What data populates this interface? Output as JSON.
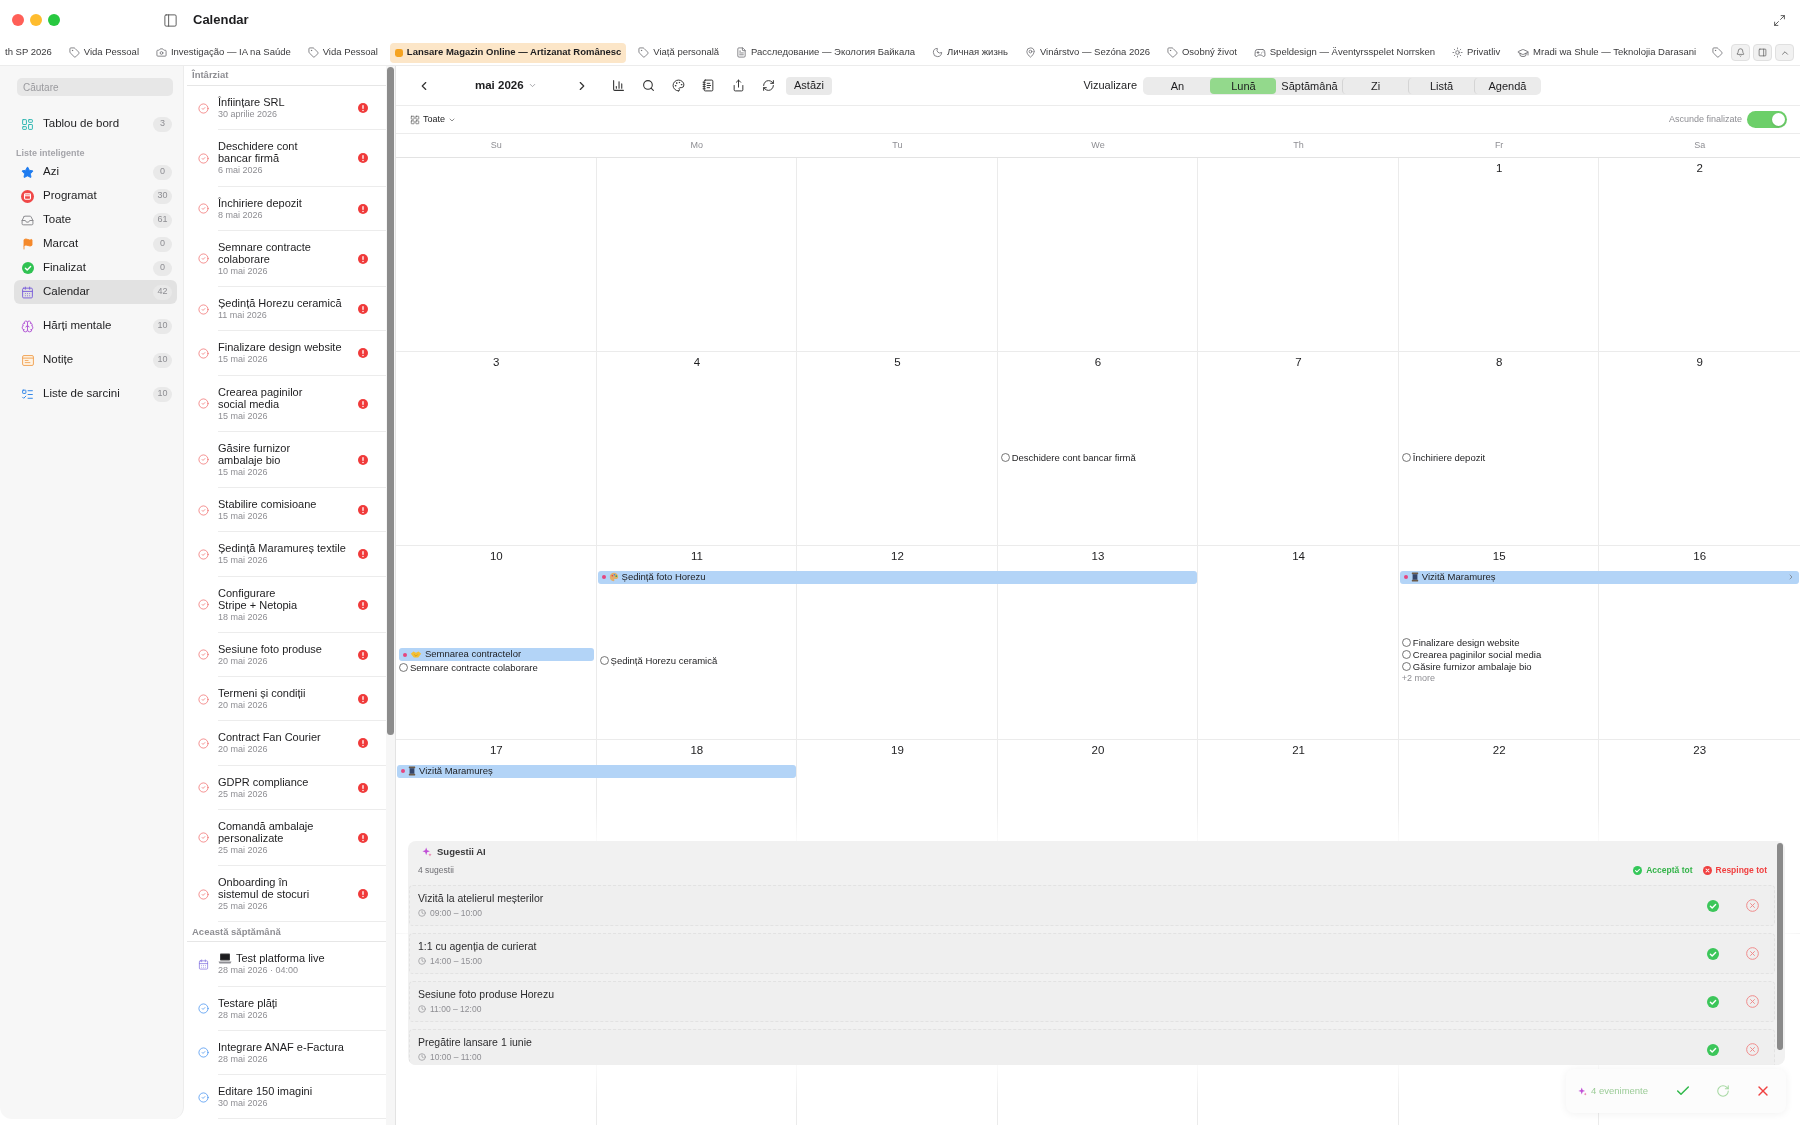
{
  "window": {
    "title": "Calendar"
  },
  "tabs": [
    {
      "label": "th SP 2026",
      "selected": false
    },
    {
      "label": "Vida Pessoal",
      "selected": false
    },
    {
      "label": "Investigação — IA na Saúde",
      "selected": false
    },
    {
      "label": "Vida Pessoal",
      "selected": false
    },
    {
      "label": "Lansare Magazin Online — Artizanat Românesc",
      "selected": true
    },
    {
      "label": "Viață personală",
      "selected": false
    },
    {
      "label": "Расследование — Экология Байкала",
      "selected": false
    },
    {
      "label": "Личная жизнь",
      "selected": false
    },
    {
      "label": "Vinárstvo — Sezóna 2026",
      "selected": false
    },
    {
      "label": "Osobný život",
      "selected": false
    },
    {
      "label": "Speldesign — Äventyrsspelet Norrsken",
      "selected": false
    },
    {
      "label": "Privatliv",
      "selected": false
    },
    {
      "label": "Mradi wa Shule — Teknolojia Darasani",
      "selected": false
    }
  ],
  "sidebar": {
    "search": {
      "placeholder": "Căutare"
    },
    "top_items": [
      {
        "label": "Tablou de bord",
        "count": "3",
        "selected": false
      }
    ],
    "smart_lists": {
      "title": "Liste inteligente",
      "items": [
        {
          "label": "Azi",
          "count": "0",
          "selected": false
        },
        {
          "label": "Programat",
          "count": "30",
          "selected": false
        },
        {
          "label": "Toate",
          "count": "61",
          "selected": false
        },
        {
          "label": "Marcat",
          "count": "0",
          "selected": false
        },
        {
          "label": "Finalizat",
          "count": "0",
          "selected": false
        },
        {
          "label": "Calendar",
          "count": "42",
          "selected": true
        }
      ]
    },
    "bottom_items": [
      {
        "label": "Hărți mentale",
        "count": "10",
        "selected": false
      },
      {
        "label": "Notițe",
        "count": "10",
        "selected": false
      },
      {
        "label": "Liste de sarcini",
        "count": "10",
        "selected": false
      }
    ]
  },
  "task_list": {
    "groups": [
      {
        "title": "Întârziat",
        "items": [
          {
            "kind": "task",
            "title": "Înființare SRL",
            "date": "30 aprilie 2026",
            "overdue": true
          },
          {
            "kind": "task",
            "title": "Deschidere cont bancar firmă",
            "date": "6 mai 2026",
            "overdue": true
          },
          {
            "kind": "task",
            "title": "Închiriere depozit",
            "date": "8 mai 2026",
            "overdue": true
          },
          {
            "kind": "task",
            "title": "Semnare contracte colaborare",
            "date": "10 mai 2026",
            "overdue": true
          },
          {
            "kind": "task",
            "title": "Ședință Horezu ceramică",
            "date": "11 mai 2026",
            "overdue": true
          },
          {
            "kind": "task",
            "title": "Finalizare design website",
            "date": "15 mai 2026",
            "overdue": true
          },
          {
            "kind": "task",
            "title": "Crearea paginilor social media",
            "date": "15 mai 2026",
            "overdue": true
          },
          {
            "kind": "task",
            "title": "Găsire furnizor ambalaje bio",
            "date": "15 mai 2026",
            "overdue": true
          },
          {
            "kind": "task",
            "title": "Stabilire comisioane",
            "date": "15 mai 2026",
            "overdue": true
          },
          {
            "kind": "task",
            "title": "Ședință Maramureș textile",
            "date": "15 mai 2026",
            "overdue": true
          },
          {
            "kind": "task",
            "title": "Configurare Stripe + Netopia",
            "date": "18 mai 2026",
            "overdue": true
          },
          {
            "kind": "task",
            "title": "Sesiune foto produse",
            "date": "20 mai 2026",
            "overdue": true
          },
          {
            "kind": "task",
            "title": "Termeni și condiții",
            "date": "20 mai 2026",
            "overdue": true
          },
          {
            "kind": "task",
            "title": "Contract Fan Courier",
            "date": "20 mai 2026",
            "overdue": true
          },
          {
            "kind": "task",
            "title": "GDPR compliance",
            "date": "25 mai 2026",
            "overdue": true
          },
          {
            "kind": "task",
            "title": "Comandă ambalaje personalizate",
            "date": "25 mai 2026",
            "overdue": true
          },
          {
            "kind": "task",
            "title": "Onboarding în sistemul de stocuri",
            "date": "25 mai 2026",
            "overdue": true
          }
        ]
      },
      {
        "title": "Această săptămână",
        "items": [
          {
            "kind": "event",
            "title": "Test platforma live",
            "date": "28 mai 2026 · 04:00",
            "overdue": false
          },
          {
            "kind": "task",
            "title": "Testare plăți",
            "date": "28 mai 2026",
            "overdue": false
          },
          {
            "kind": "task",
            "title": "Integrare ANAF e-Factura",
            "date": "28 mai 2026",
            "overdue": false
          },
          {
            "kind": "task",
            "title": "Editare 150 imagini",
            "date": "30 mai 2026",
            "overdue": false
          }
        ]
      }
    ]
  },
  "calendar": {
    "month": "mai 2026",
    "today_button": "Astăzi",
    "view_label": "Vizualizare",
    "views": [
      {
        "label": "An",
        "selected": false
      },
      {
        "label": "Lună",
        "selected": true
      },
      {
        "label": "Săptămână",
        "selected": false
      },
      {
        "label": "Zi",
        "selected": false
      },
      {
        "label": "Listă",
        "selected": false
      },
      {
        "label": "Agendă",
        "selected": false
      }
    ],
    "filter": "Toate",
    "hide_completed": {
      "label": "Ascunde finalizate",
      "on": true
    },
    "weekdays": [
      "Su",
      "Mo",
      "Tu",
      "We",
      "Th",
      "Fr",
      "Sa"
    ],
    "weeks": [
      {
        "days": [
          {
            "kind": "blank"
          },
          {
            "kind": "blank"
          },
          {
            "kind": "blank"
          },
          {
            "kind": "blank"
          },
          {
            "kind": "blank"
          },
          {
            "kind": "day",
            "number": "1",
            "bar_through": false
          },
          {
            "kind": "day",
            "number": "2",
            "bar_through": false
          }
        ]
      },
      {
        "days": [
          {
            "kind": "day",
            "number": "3",
            "bar_through": false
          },
          {
            "kind": "day",
            "number": "4",
            "bar_through": false
          },
          {
            "kind": "day",
            "number": "5",
            "bar_through": false
          },
          {
            "kind": "day",
            "number": "6",
            "bar_through": false,
            "items": [
              {
                "kind": "task",
                "title": "Deschidere cont bancar firmă"
              }
            ]
          },
          {
            "kind": "day",
            "number": "7",
            "bar_through": false
          },
          {
            "kind": "day",
            "number": "8",
            "bar_through": false,
            "items": [
              {
                "kind": "task",
                "title": "Închiriere depozit"
              }
            ]
          },
          {
            "kind": "day",
            "number": "9",
            "bar_through": false
          }
        ]
      },
      {
        "days": [
          {
            "kind": "day",
            "number": "10",
            "bar_through": false,
            "items": [
              {
                "kind": "event",
                "title": "Semnarea contractelor"
              },
              {
                "kind": "task",
                "title": "Semnare contracte colaborare"
              }
            ]
          },
          {
            "kind": "day",
            "number": "11",
            "bar_through": false,
            "bar": {
              "title": "Ședință foto Horezu",
              "continues": false
            },
            "items": [
              {
                "kind": "task",
                "title": "Ședință Horezu ceramică"
              }
            ]
          },
          {
            "kind": "day",
            "number": "12",
            "bar_through": true
          },
          {
            "kind": "day",
            "number": "13",
            "bar_through": true
          },
          {
            "kind": "day",
            "number": "14",
            "bar_through": false
          },
          {
            "kind": "day",
            "number": "15",
            "bar_through": false,
            "bar": {
              "title": "Vizită Maramureș",
              "continues": true
            },
            "items": [
              {
                "kind": "task",
                "title": "Finalizare design website"
              },
              {
                "kind": "task",
                "title": "Crearea paginilor social media"
              },
              {
                "kind": "task",
                "title": "Găsire furnizor ambalaje bio"
              },
              {
                "kind": "more",
                "title": "+2 more"
              }
            ]
          },
          {
            "kind": "day",
            "number": "16",
            "bar_through": true
          }
        ]
      },
      {
        "days": [
          {
            "kind": "day",
            "number": "17",
            "bar_through": false,
            "bar": {
              "title": "Vizită Maramureș",
              "continues": false
            }
          },
          {
            "kind": "day",
            "number": "18",
            "bar_through": true
          },
          {
            "kind": "day",
            "number": "19",
            "bar_through": false
          },
          {
            "kind": "day",
            "number": "20",
            "bar_through": false
          },
          {
            "kind": "day",
            "number": "21",
            "bar_through": false
          },
          {
            "kind": "day",
            "number": "22",
            "bar_through": false
          },
          {
            "kind": "day",
            "number": "23",
            "bar_through": false
          }
        ]
      }
    ]
  },
  "ai_suggestions": {
    "title": "Sugestii AI",
    "count": "4 sugestii",
    "accept_all": "Acceptă tot",
    "reject_all": "Respinge tot",
    "items": [
      {
        "title": "Vizită la atelierul meșterilor",
        "time": "09:00 – 10:00"
      },
      {
        "title": "1:1 cu agenția de curierat",
        "time": "14:00 – 15:00"
      },
      {
        "title": "Sesiune foto produse Horezu",
        "time": "11:00 – 12:00"
      },
      {
        "title": "Pregătire lansare 1 iunie",
        "time": "10:00 – 11:00"
      }
    ]
  },
  "event_bar": {
    "label": "4 evenimente"
  }
}
